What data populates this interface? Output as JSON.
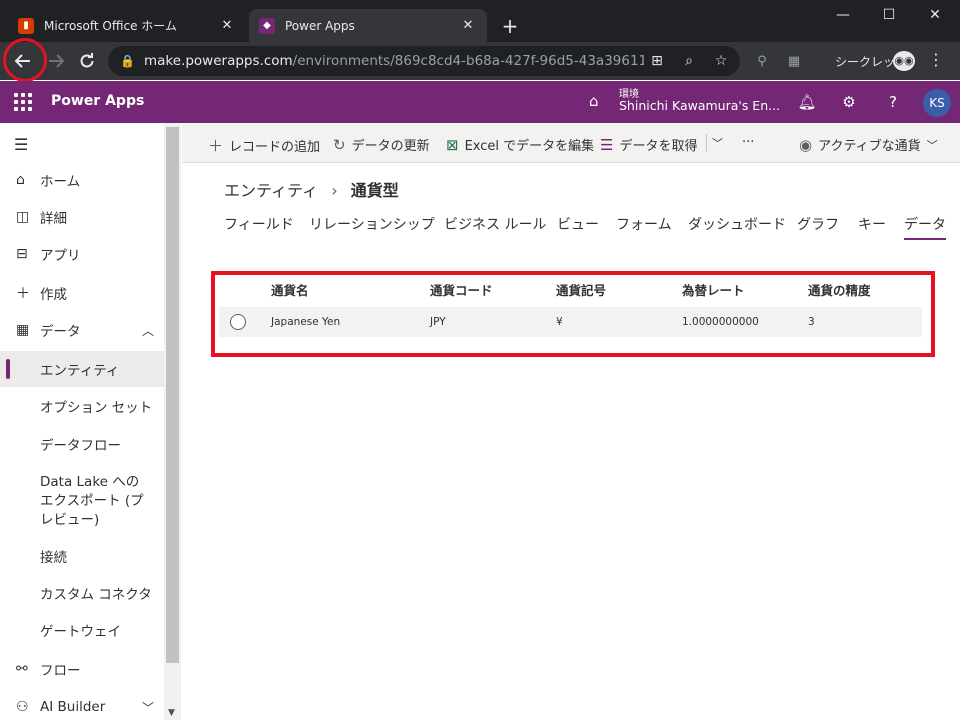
{
  "browser": {
    "tabs": [
      {
        "title": "Microsoft Office ホーム",
        "favicon": "office-icon",
        "active": false
      },
      {
        "title": "Power Apps",
        "favicon": "powerapps-icon",
        "active": true
      }
    ],
    "url_host": "make.powerapps.com",
    "url_path": "/environments/869c8cd4-b68a-427f-96d5-43a39611bd...",
    "incognito_label": "シークレット",
    "colors": {
      "tabstrip": "#202124",
      "toolbar": "#35363a",
      "highlight": "#e81123"
    }
  },
  "header": {
    "brand": "Power Apps",
    "env_label": "環境",
    "env_name": "Shinichi Kawamura's En...",
    "avatar_initials": "KS",
    "color": "#742774"
  },
  "nav": {
    "items": [
      {
        "label": "ホーム",
        "icon": "home-icon"
      },
      {
        "label": "詳細",
        "icon": "book-icon"
      },
      {
        "label": "アプリ",
        "icon": "apps-icon"
      },
      {
        "label": "作成",
        "icon": "plus-icon"
      },
      {
        "label": "データ",
        "icon": "table-icon"
      },
      {
        "label": "エンティティ",
        "selected": true
      },
      {
        "label": "オプション セット"
      },
      {
        "label": "データフロー"
      },
      {
        "label": "Data Lake へのエクスポート (プレビュー)"
      },
      {
        "label": "接続"
      },
      {
        "label": "カスタム コネクタ"
      },
      {
        "label": "ゲートウェイ"
      },
      {
        "label": "フロー",
        "icon": "flow-icon"
      },
      {
        "label": "AI Builder",
        "icon": "ai-icon"
      }
    ]
  },
  "commands": {
    "add_record": "レコードの追加",
    "refresh": "データの更新",
    "excel": "Excel でデータを編集",
    "get_data": "データを取得",
    "more": "···",
    "view": "アクティブな通貨"
  },
  "breadcrumb": {
    "parent": "エンティティ",
    "current": "通貨型"
  },
  "tabs": [
    "フィールド",
    "リレーションシップ",
    "ビジネス ルール",
    "ビュー",
    "フォーム",
    "ダッシュボード",
    "グラフ",
    "キー",
    "データ"
  ],
  "active_tab": "データ",
  "grid": {
    "columns": [
      "通貨名",
      "通貨コード",
      "通貨記号",
      "為替レート",
      "通貨の精度"
    ],
    "rows": [
      [
        "Japanese Yen",
        "JPY",
        "¥",
        "1.0000000000",
        "3"
      ]
    ]
  }
}
